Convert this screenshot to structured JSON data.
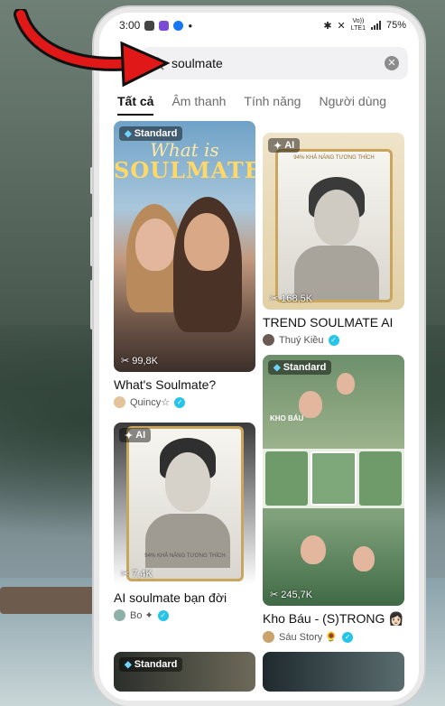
{
  "status_bar": {
    "time": "3:00",
    "battery": "75%",
    "net_top": "Vo))",
    "net_bottom": "LTE1"
  },
  "search": {
    "query": "soulmate",
    "clear_icon": "close-circle-icon",
    "search_icon": "search-icon"
  },
  "tabs": [
    {
      "label": "Tất cả",
      "active": true
    },
    {
      "label": "Âm thanh",
      "active": false
    },
    {
      "label": "Tính năng",
      "active": false
    },
    {
      "label": "Người dùng",
      "active": false
    }
  ],
  "results": [
    {
      "badge": "Standard",
      "thumb_text_1": "What is",
      "thumb_text_2": "SOULMATE?",
      "uses": "99,8K",
      "title": "What's Soulmate?",
      "author": "Quincy☆",
      "verified": true
    },
    {
      "badge": "AI",
      "thumb_caption": "94% KHẢ NĂNG TƯƠNG THÍCH",
      "uses": "168,5K",
      "title": "TREND SOULMATE AI",
      "author": "Thuý Kiều",
      "verified": true
    },
    {
      "badge": "Standard",
      "thumb_caption": "KHO BÁU",
      "uses": "245,7K",
      "title": "Kho Báu - (S)TRONG 👩🏻",
      "author": "Sáu Story 🌻",
      "verified": true
    },
    {
      "badge": "AI",
      "thumb_caption": "94% KHẢ NĂNG TƯƠNG THÍCH",
      "uses": "7,4K",
      "title": "AI soulmate bạn đời",
      "author": "Bo ✦",
      "verified": true
    },
    {
      "badge": "Standard"
    }
  ],
  "colors": {
    "verified": "#25c4e8",
    "frame_gold": "#c9a65c",
    "arrow_red": "#e01818"
  }
}
